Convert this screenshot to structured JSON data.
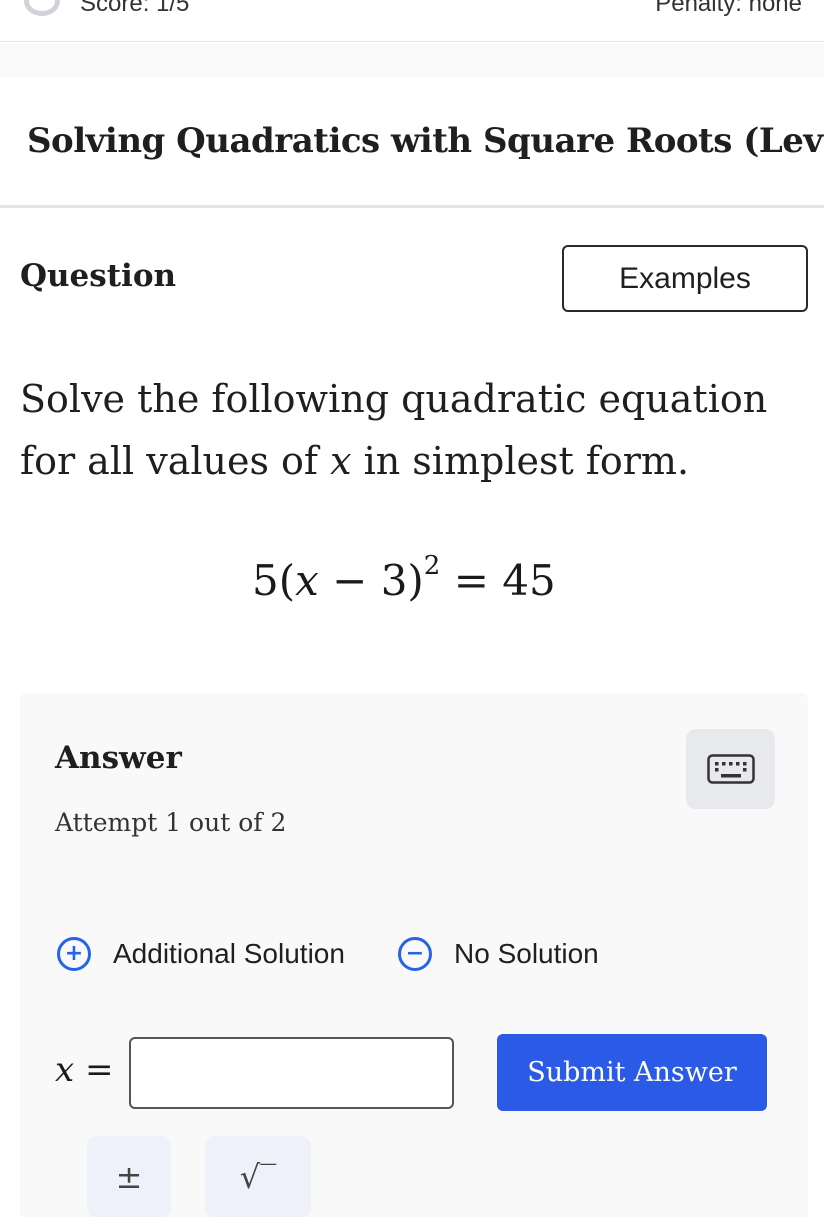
{
  "header": {
    "score_text": "Score: 1/5",
    "penalty_text": "Penalty: none"
  },
  "title": "Solving Quadratics with Square Roots (Level",
  "question": {
    "heading": "Question",
    "examples_label": "Examples",
    "prompt_part1": "Solve the following quadratic equation for all values of ",
    "prompt_var": "x",
    "prompt_part2": " in simplest form.",
    "equation": {
      "coef": "5(",
      "var": "x",
      "rest": " − 3)",
      "exponent": "2",
      "rhs": " = 45"
    }
  },
  "answer": {
    "heading": "Answer",
    "attempt_text": "Attempt 1 out of 2",
    "additional_solution_label": "Additional Solution",
    "no_solution_label": "No Solution",
    "variable": "x",
    "equals": " =",
    "input_value": "",
    "submit_label": "Submit Answer",
    "plus_minus_symbol": "±",
    "sqrt_symbol": "√‾"
  },
  "icons": {
    "keyboard": "keyboard-icon",
    "add": "plus-circle-icon",
    "remove": "minus-circle-icon"
  },
  "colors": {
    "accent": "#2563eb",
    "submit": "#2a5ae6"
  }
}
